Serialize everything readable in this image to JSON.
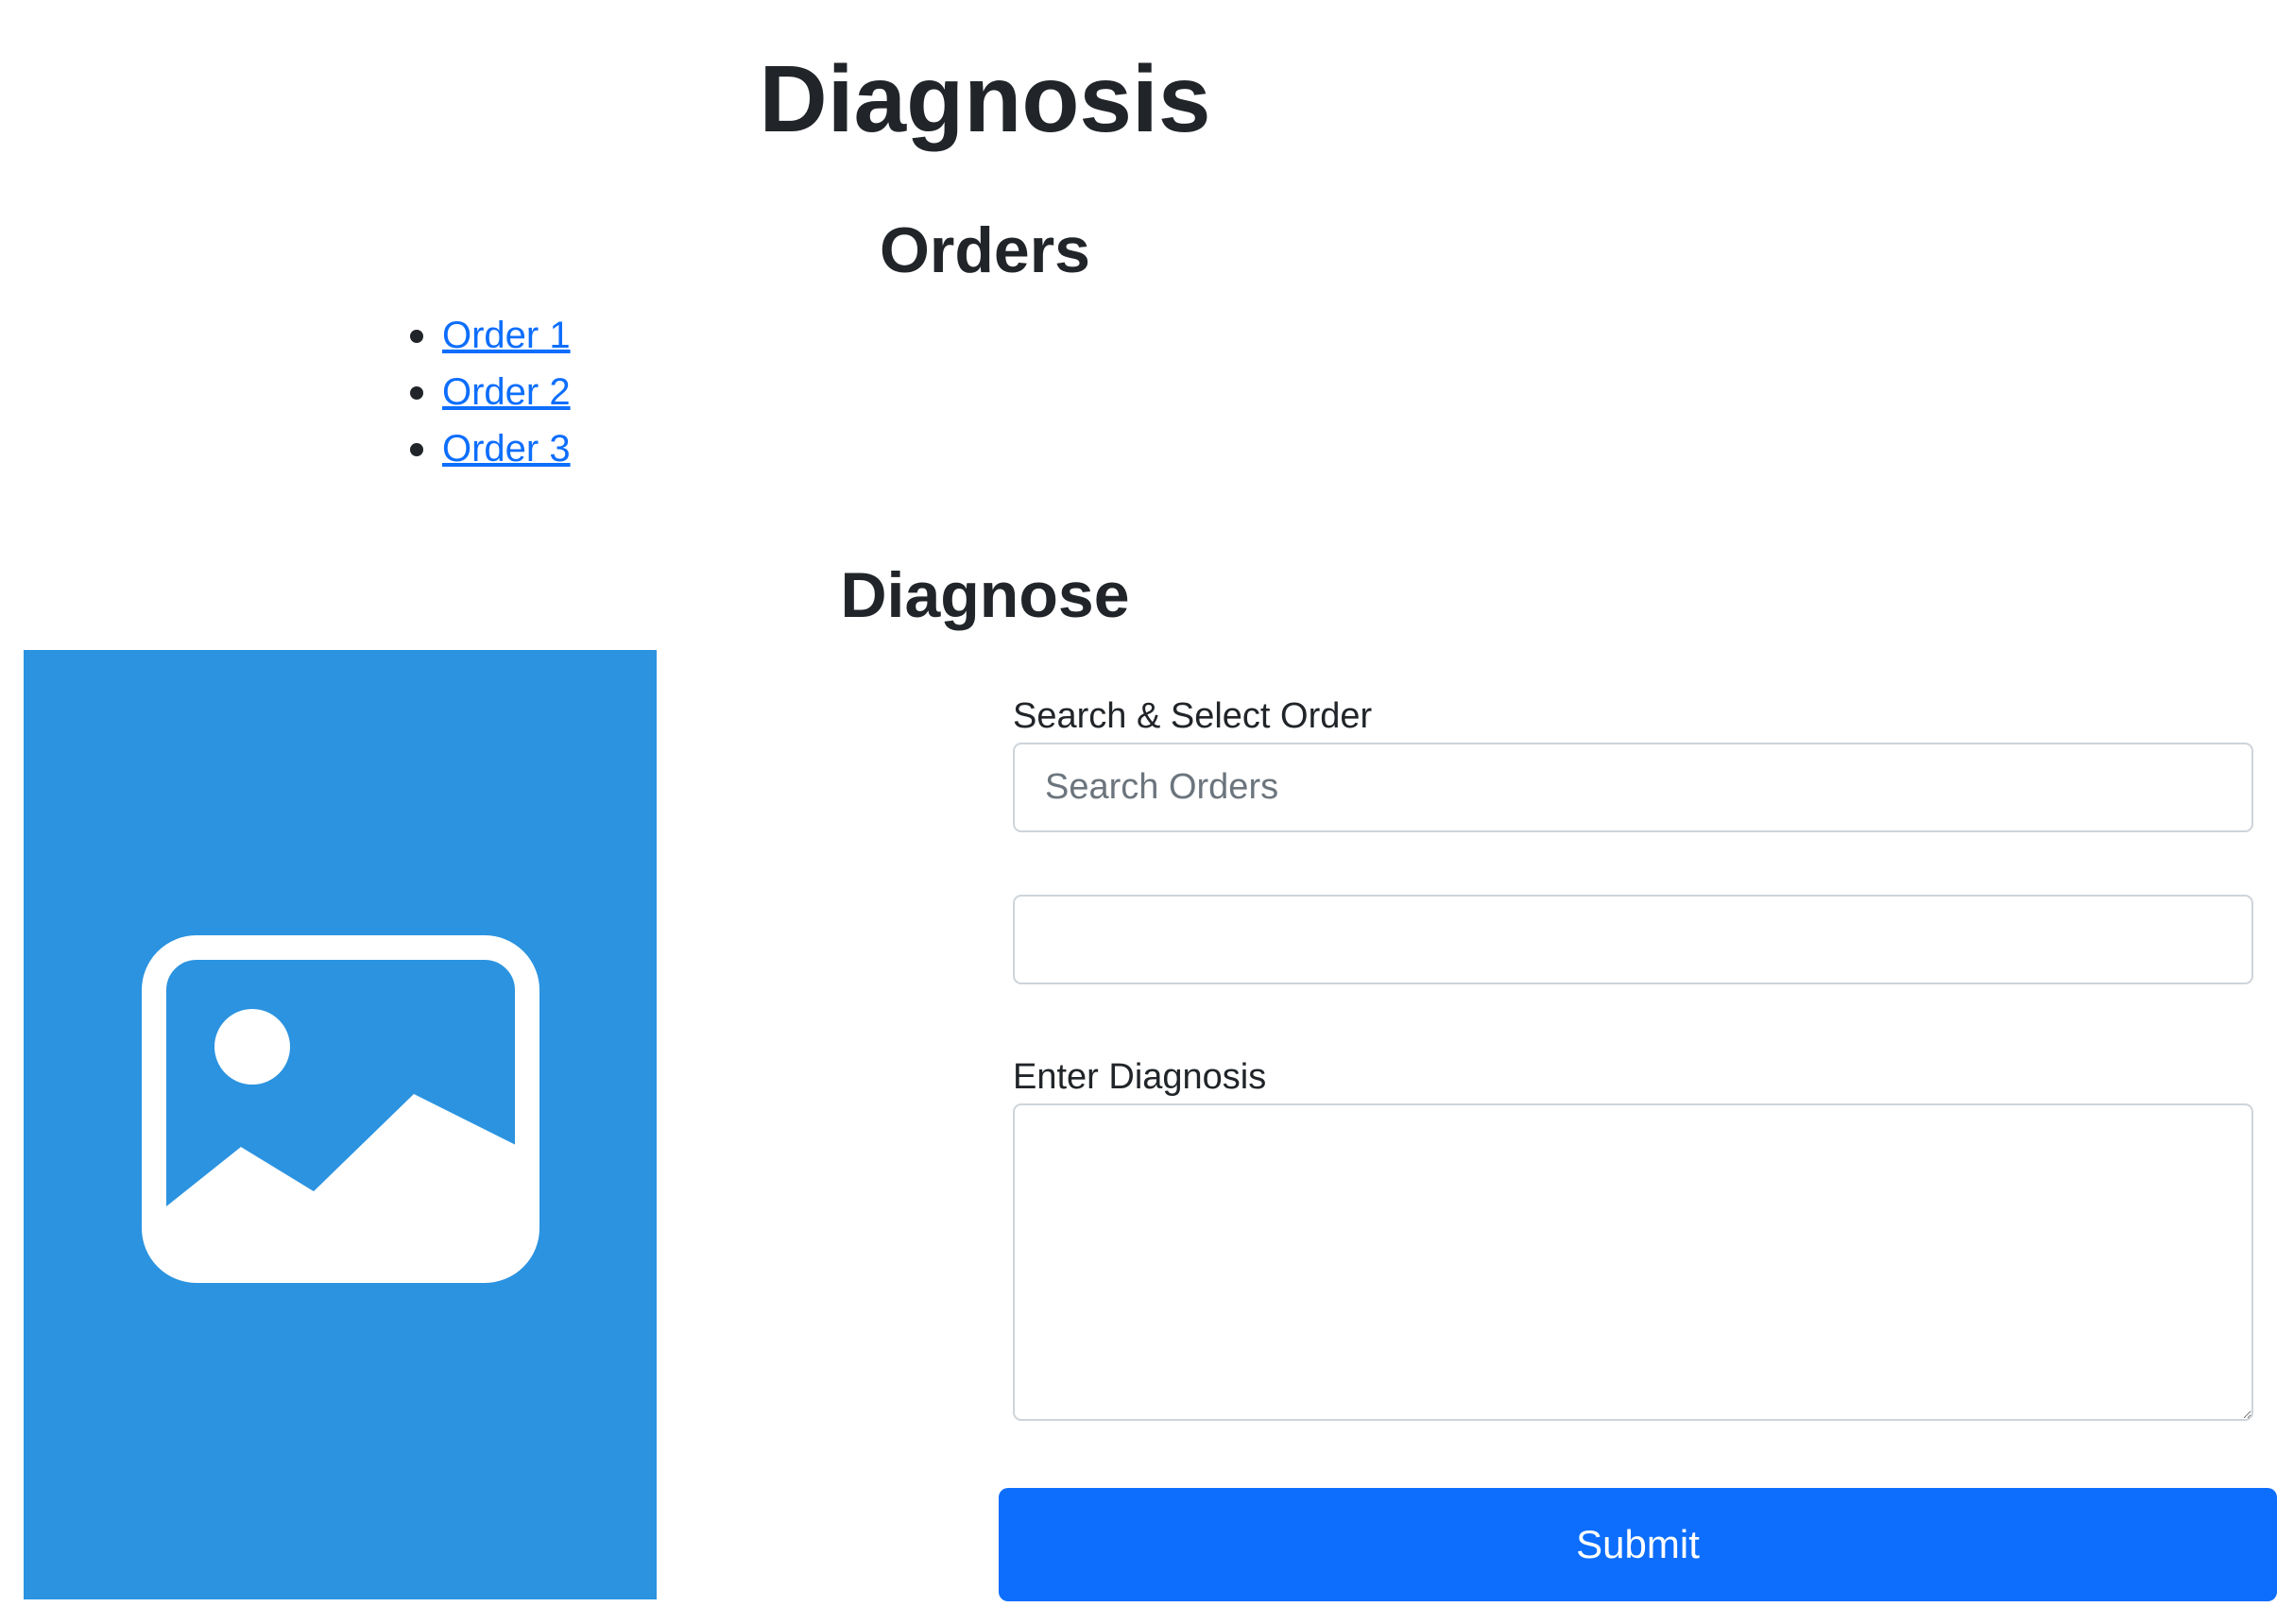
{
  "page": {
    "title": "Diagnosis"
  },
  "orders": {
    "heading": "Orders",
    "items": [
      {
        "label": "Order 1"
      },
      {
        "label": "Order 2"
      },
      {
        "label": "Order 3"
      }
    ],
    "link_color": "#0d6efd"
  },
  "diagnose": {
    "heading": "Diagnose",
    "image_icon": "image-placeholder-icon",
    "image_bg_color": "#2b93e0",
    "search_label": "Search & Select Order",
    "search_placeholder": "Search Orders",
    "search_value": "",
    "select_value": "",
    "diagnosis_label": "Enter Diagnosis",
    "diagnosis_value": "",
    "submit_label": "Submit",
    "submit_color": "#0d6efd"
  }
}
